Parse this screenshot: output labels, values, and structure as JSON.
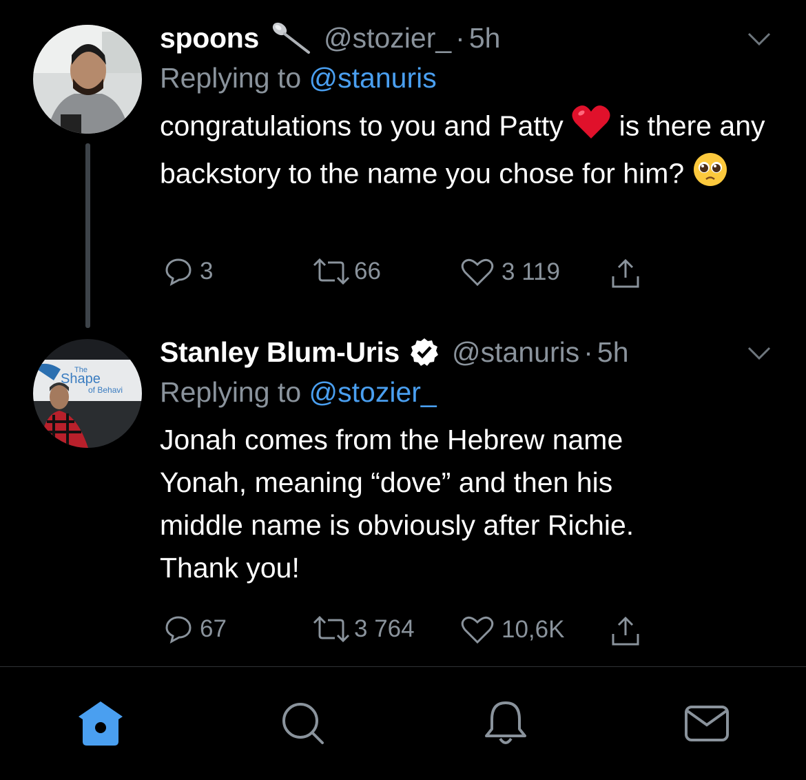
{
  "tweets": [
    {
      "name": "spoons",
      "handle": "@stozier_",
      "separator": "·",
      "time": "5h",
      "replying_prefix": "Replying to",
      "replying_to": "@stanuris",
      "text_part1": "congratulations to you and Patty",
      "text_part2": "is there any backstory to the name you chose for him?",
      "replies": "3",
      "retweets": "66",
      "likes": "3 119"
    },
    {
      "name": "Stanley Blum-Uris",
      "handle": "@stanuris",
      "separator": "·",
      "time": "5h",
      "replying_prefix": "Replying to",
      "replying_to": "@stozier_",
      "text": "Jonah comes from the Hebrew name Yonah, meaning “dove” and then his middle name is obviously after Richie. Thank you!",
      "avatar_sign_line1": "The",
      "avatar_sign_line2": "Shape",
      "avatar_sign_line3": "of Behavi",
      "replies": "67",
      "retweets": "3 764",
      "likes": "10,6K"
    }
  ],
  "tabs": [
    {
      "name": "home",
      "icon": "home-icon",
      "active": true
    },
    {
      "name": "search",
      "icon": "search-icon",
      "active": false
    },
    {
      "name": "notifications",
      "icon": "bell-icon",
      "active": false
    },
    {
      "name": "messages",
      "icon": "mail-icon",
      "active": false
    }
  ],
  "colors": {
    "background": "#000000",
    "secondary_text": "#8a939c",
    "link": "#4a9ff0",
    "active_tab": "#4a9ff0",
    "thread_line": "#3d4349"
  }
}
